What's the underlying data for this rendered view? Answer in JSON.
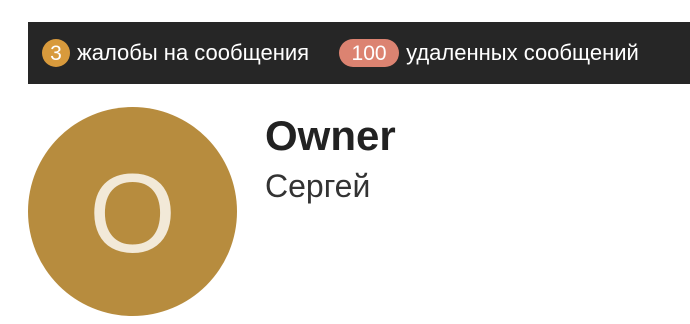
{
  "stats": {
    "reports": {
      "count": "3",
      "label": "жалобы на сообщения"
    },
    "deleted": {
      "count": "100",
      "label": "удаленных сообщений"
    }
  },
  "colors": {
    "bar_background": "#262626",
    "reports_badge": "#d89a3c",
    "deleted_badge": "#dc8371",
    "avatar_background": "#b78c3e"
  },
  "profile": {
    "avatar_letter": "O",
    "role": "Owner",
    "name": "Сергей"
  }
}
